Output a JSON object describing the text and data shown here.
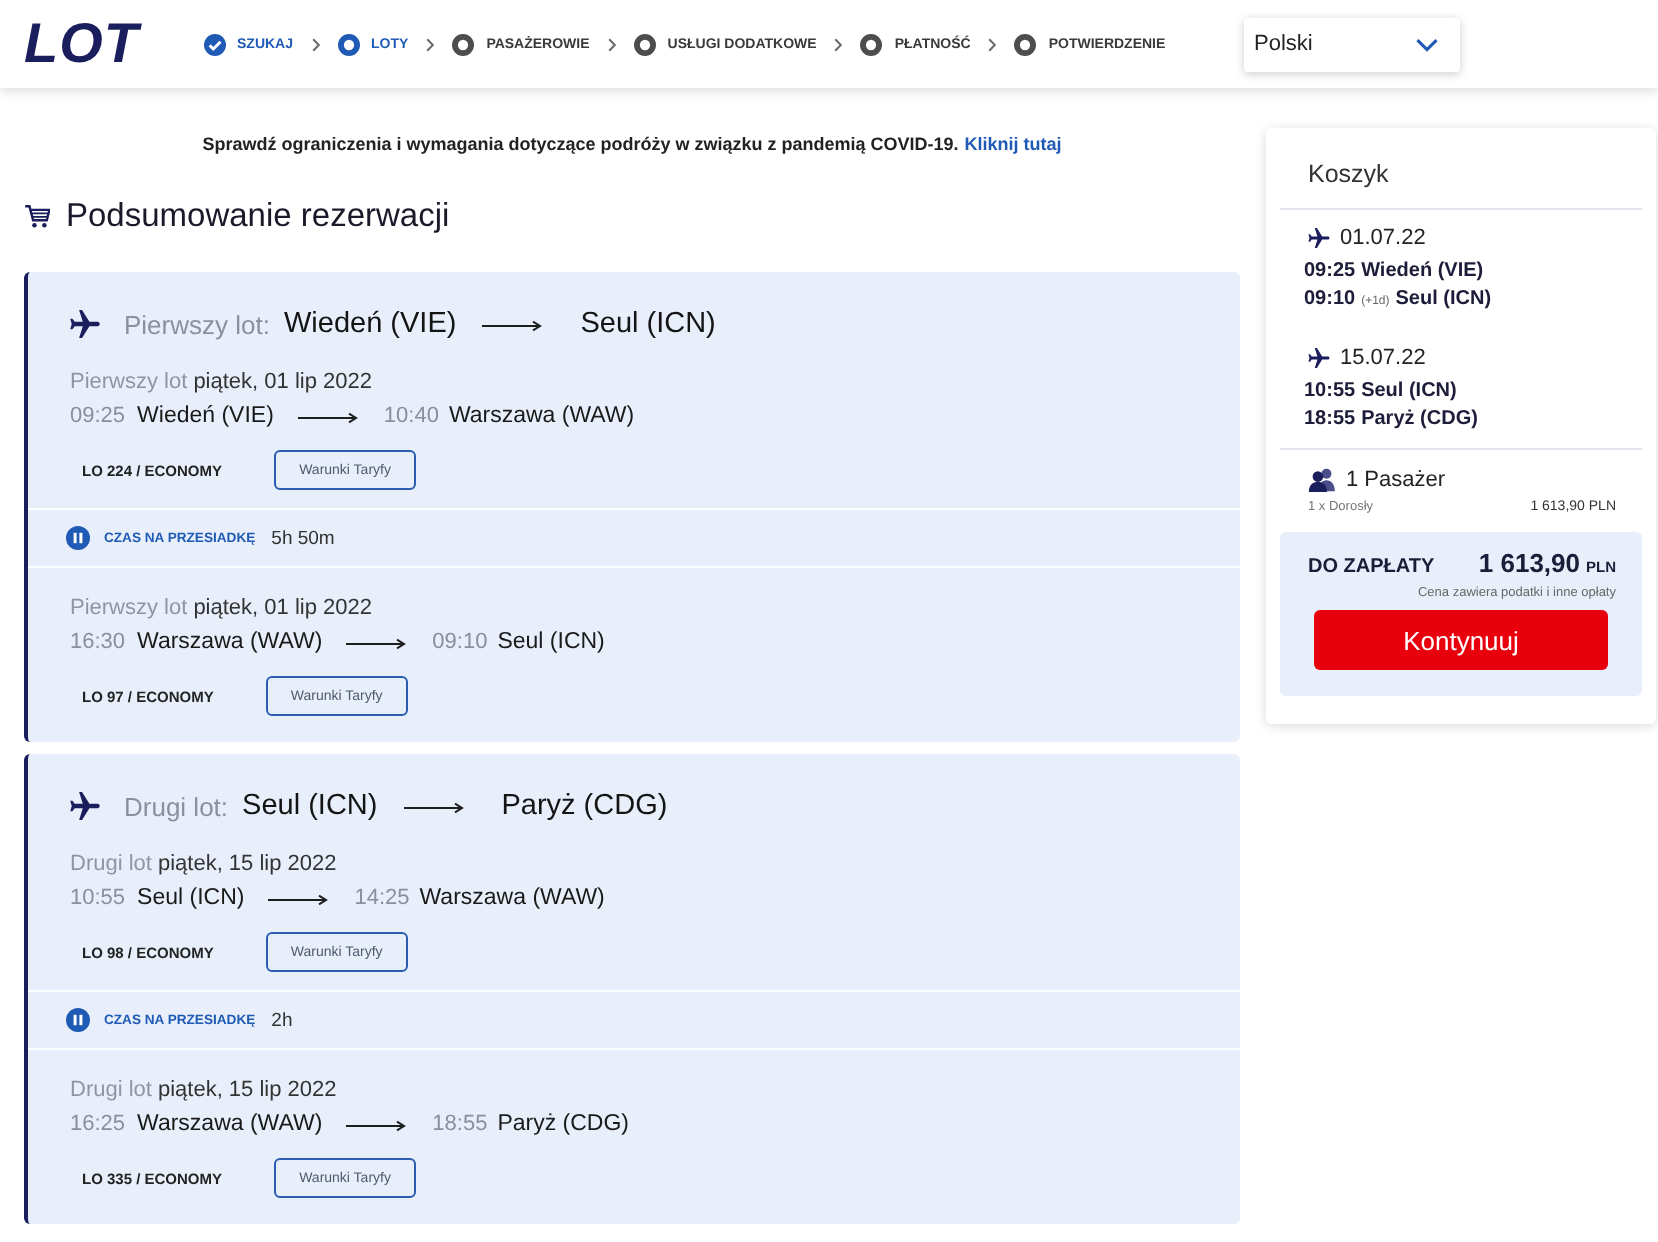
{
  "header": {
    "logo": "LOT",
    "steps": [
      {
        "label": "SZUKAJ",
        "completed": true,
        "selected": false
      },
      {
        "label": "LOTY",
        "completed": false,
        "selected": true
      },
      {
        "label": "PASAŻEROWIE",
        "completed": false,
        "selected": false
      },
      {
        "label": "USŁUGI DODATKOWE",
        "completed": false,
        "selected": false
      },
      {
        "label": "PŁATNOŚĆ",
        "completed": false,
        "selected": false
      },
      {
        "label": "POTWIERDZENIE",
        "completed": false,
        "selected": false
      }
    ],
    "language_select": {
      "value": "Polski"
    }
  },
  "notice": {
    "text": "Sprawdź ograniczenia i wymagania dotyczące podróży w związku z pandemią COVID-19.",
    "link": "Kliknij tutaj"
  },
  "summary": {
    "title": "Podsumowanie rezerwacji",
    "flights": [
      {
        "label": "Pierwszy lot:",
        "origin": "Wiedeń (VIE)",
        "destination": "Seul (ICN)",
        "parts": [
          {
            "kind": "segment",
            "label": "Pierwszy lot",
            "date": "piątek, 01 lip 2022",
            "departure_time": "09:25",
            "departure": "Wiedeń (VIE)",
            "arrival_time": "10:40",
            "arrival": "Warszawa (WAW)",
            "flight": "LO 224 / ECONOMY",
            "button": "Warunki Taryfy"
          },
          {
            "kind": "layover",
            "label": "CZAS NA PRZESIADKĘ",
            "duration": "5h 50m"
          },
          {
            "kind": "segment",
            "label": "Pierwszy lot",
            "date": "piątek, 01 lip 2022",
            "departure_time": "16:30",
            "departure": "Warszawa (WAW)",
            "arrival_time": "09:10",
            "arrival": "Seul (ICN)",
            "flight": "LO 97 / ECONOMY",
            "button": "Warunki Taryfy"
          }
        ]
      },
      {
        "label": "Drugi lot:",
        "origin": "Seul (ICN)",
        "destination": "Paryż (CDG)",
        "parts": [
          {
            "kind": "segment",
            "label": "Drugi lot",
            "date": "piątek, 15 lip 2022",
            "departure_time": "10:55",
            "departure": "Seul (ICN)",
            "arrival_time": "14:25",
            "arrival": "Warszawa (WAW)",
            "flight": "LO 98 / ECONOMY",
            "button": "Warunki Taryfy"
          },
          {
            "kind": "layover",
            "label": "CZAS NA PRZESIADKĘ",
            "duration": "2h"
          },
          {
            "kind": "segment",
            "label": "Drugi lot",
            "date": "piątek, 15 lip 2022",
            "departure_time": "16:25",
            "departure": "Warszawa (WAW)",
            "arrival_time": "18:55",
            "arrival": "Paryż (CDG)",
            "flight": "LO 335 / ECONOMY",
            "button": "Warunki Taryfy"
          }
        ]
      }
    ]
  },
  "cart": {
    "title": "Koszyk",
    "flights": [
      {
        "date": "01.07.22",
        "stops": [
          {
            "time": "09:25",
            "place": "Wiedeń (VIE)"
          },
          {
            "time": "09:10",
            "day_offset": "(+1d)",
            "place": "Seul (ICN)"
          }
        ]
      },
      {
        "date": "15.07.22",
        "stops": [
          {
            "time": "10:55",
            "place": "Seul (ICN)"
          },
          {
            "time": "18:55",
            "place": "Paryż (CDG)"
          }
        ]
      }
    ],
    "passengers": {
      "label": "1 Pasażer",
      "type": "1 x Dorosły",
      "price": "1 613,90 PLN"
    },
    "total": {
      "label": "DO ZAPŁATY",
      "amount": "1 613,90",
      "currency": "PLN",
      "note": "Cena zawiera podatki i inne opłaty",
      "button": "Kontynuuj"
    }
  }
}
